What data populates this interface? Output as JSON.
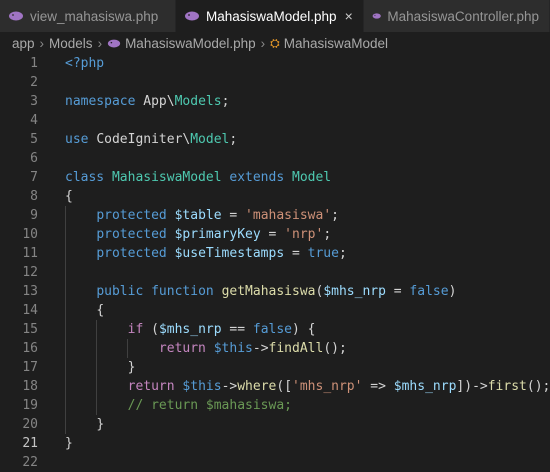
{
  "tabs": [
    {
      "label": "view_mahasiswa.php",
      "active": false
    },
    {
      "label": "MahasiswaModel.php",
      "active": true,
      "close": "×"
    },
    {
      "label": "MahasiswaController.php",
      "active": false
    }
  ],
  "breadcrumb": {
    "items": [
      "app",
      "Models",
      "MahasiswaModel.php",
      "MahasiswaModel"
    ],
    "separator": "›"
  },
  "editor": {
    "current_line": 21,
    "lines": [
      {
        "n": "1",
        "code": "<?php"
      },
      {
        "n": "2",
        "code": ""
      },
      {
        "n": "3",
        "code": "namespace App\\Models;"
      },
      {
        "n": "4",
        "code": ""
      },
      {
        "n": "5",
        "code": "use CodeIgniter\\Model;"
      },
      {
        "n": "6",
        "code": ""
      },
      {
        "n": "7",
        "code": "class MahasiswaModel extends Model"
      },
      {
        "n": "8",
        "code": "{"
      },
      {
        "n": "9",
        "code": "    protected $table = 'mahasiswa';"
      },
      {
        "n": "10",
        "code": "    protected $primaryKey = 'nrp';"
      },
      {
        "n": "11",
        "code": "    protected $useTimestamps = true;"
      },
      {
        "n": "12",
        "code": ""
      },
      {
        "n": "13",
        "code": "    public function getMahasiswa($mhs_nrp = false)"
      },
      {
        "n": "14",
        "code": "    {"
      },
      {
        "n": "15",
        "code": "        if ($mhs_nrp == false) {"
      },
      {
        "n": "16",
        "code": "            return $this->findAll();"
      },
      {
        "n": "17",
        "code": "        }"
      },
      {
        "n": "18",
        "code": "        return $this->where(['mhs_nrp' => $mhs_nrp])->first();"
      },
      {
        "n": "19",
        "code": "        // return $mahasiswa;"
      },
      {
        "n": "20",
        "code": "    }"
      },
      {
        "n": "21",
        "code": "}"
      },
      {
        "n": "22",
        "code": ""
      }
    ]
  },
  "colors": {
    "background": "#1e1e1e",
    "keyword": "#569cd6",
    "control": "#c586c0",
    "class": "#4ec9b0",
    "variable": "#9cdcfe",
    "string": "#ce9178",
    "function": "#dcdcaa",
    "comment": "#6a9955"
  },
  "icons": {
    "php": "php-elephant-icon",
    "class": "class-symbol-icon",
    "close": "close-icon"
  }
}
